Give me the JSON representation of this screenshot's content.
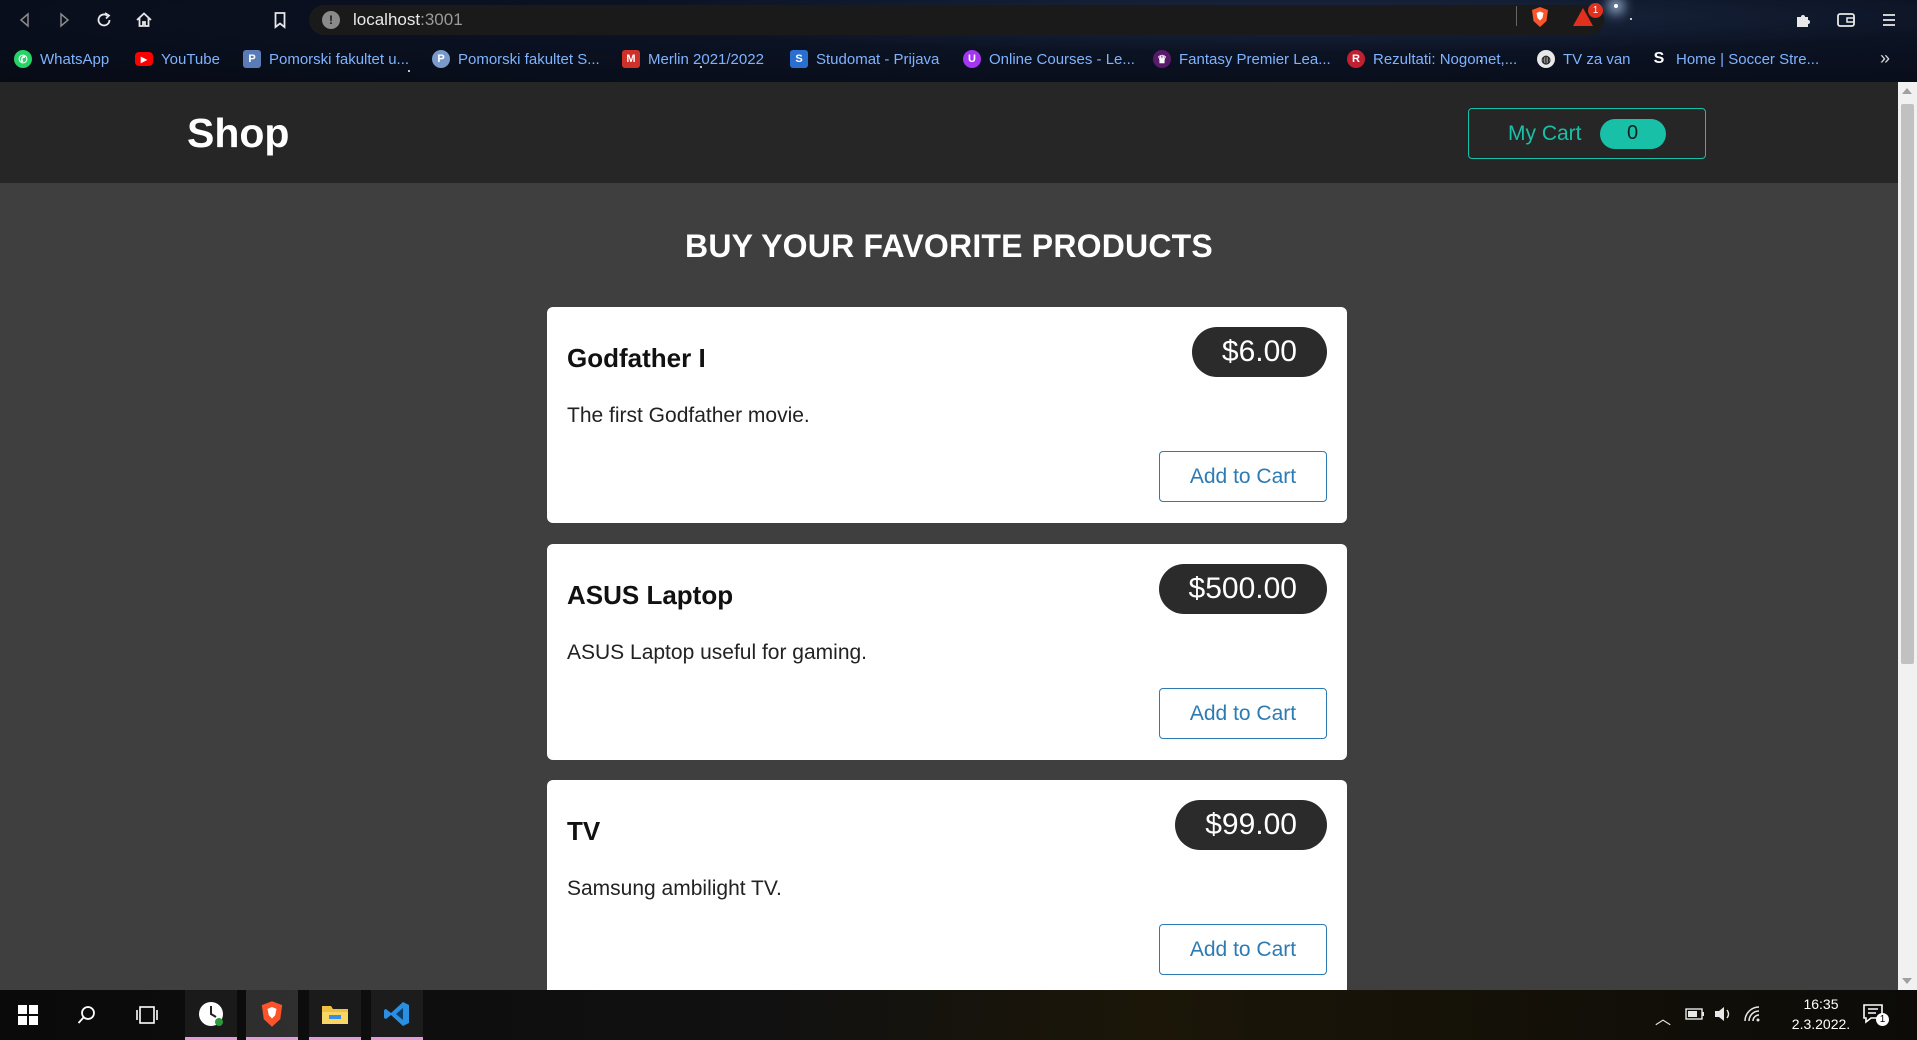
{
  "browser": {
    "url_host": "localhost",
    "url_port": ":3001",
    "rewards_badge": "1",
    "bookmarks": [
      {
        "label": "WhatsApp",
        "icon": "whatsapp-icon",
        "color": "#25d366"
      },
      {
        "label": "YouTube",
        "icon": "youtube-icon",
        "color": "#ff0000"
      },
      {
        "label": "Pomorski fakultet u...",
        "icon": "pomorski-icon",
        "color": "#5a7bb5"
      },
      {
        "label": "Pomorski fakultet S...",
        "icon": "pomorski-s-icon",
        "color": "#7a9acb"
      },
      {
        "label": "Merlin 2021/2022",
        "icon": "merlin-icon",
        "color": "#d0302a"
      },
      {
        "label": "Studomat - Prijava",
        "icon": "studomat-icon",
        "color": "#2a6fd0"
      },
      {
        "label": "Online Courses - Le...",
        "icon": "udemy-icon",
        "color": "#a435f0"
      },
      {
        "label": "Fantasy Premier Lea...",
        "icon": "premier-league-icon",
        "color": "#5a1a6a"
      },
      {
        "label": "Rezultati: Nogomet,...",
        "icon": "rezultati-icon",
        "color": "#c02030"
      },
      {
        "label": "TV za van",
        "icon": "globe-icon",
        "color": "#e8e8e8"
      },
      {
        "label": "Home | Soccer Stre...",
        "icon": "soccer-streams-icon",
        "color": "#ffffff"
      }
    ]
  },
  "shop": {
    "brand": "Shop",
    "cart_label": "My Cart",
    "cart_count": "0",
    "heading": "BUY YOUR FAVORITE PRODUCTS",
    "add_label": "Add to Cart",
    "products": [
      {
        "title": "Godfather I",
        "price": "$6.00",
        "description": "The first Godfather movie."
      },
      {
        "title": "ASUS Laptop",
        "price": "$500.00",
        "description": "ASUS Laptop useful for gaming."
      },
      {
        "title": "TV",
        "price": "$99.00",
        "description": "Samsung ambilight TV."
      }
    ]
  },
  "taskbar": {
    "time": "16:35",
    "date": "2.3.2022.",
    "notification_count": "1"
  },
  "colors": {
    "accent": "#18c0a8",
    "add_button": "#2d7bb3",
    "page_bg": "#3f3f3f",
    "navbar_bg": "#262626"
  }
}
